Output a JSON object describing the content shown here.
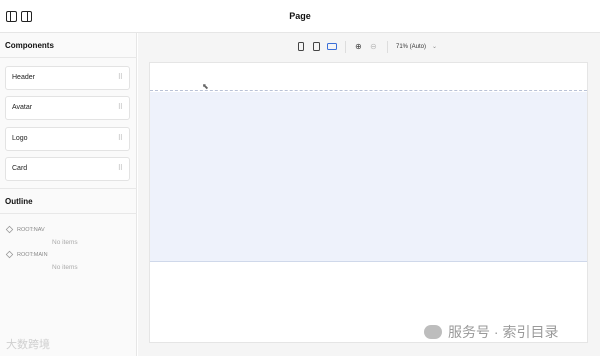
{
  "header": {
    "title": "Page"
  },
  "sidebar": {
    "components_title": "Components",
    "components": [
      {
        "label": "Header"
      },
      {
        "label": "Avatar"
      },
      {
        "label": "Logo"
      },
      {
        "label": "Card"
      }
    ],
    "grip_glyph": "⠿",
    "outline_title": "Outline",
    "outline": [
      {
        "label": "ROOT:NAV",
        "empty": "No items"
      },
      {
        "label": "ROOT:MAIN",
        "empty": "No items"
      }
    ]
  },
  "toolbar": {
    "zoom_in_glyph": "⊕",
    "zoom_out_glyph": "⊖",
    "zoom_label": "71% (Auto)",
    "chevron_glyph": "⌄",
    "active_device": "desktop",
    "accent_color": "#3b6fd8"
  },
  "canvas": {
    "cursor_glyph": "⬉"
  },
  "watermark": {
    "left": "大数跨境",
    "right": "服务号 · 索引目录"
  }
}
